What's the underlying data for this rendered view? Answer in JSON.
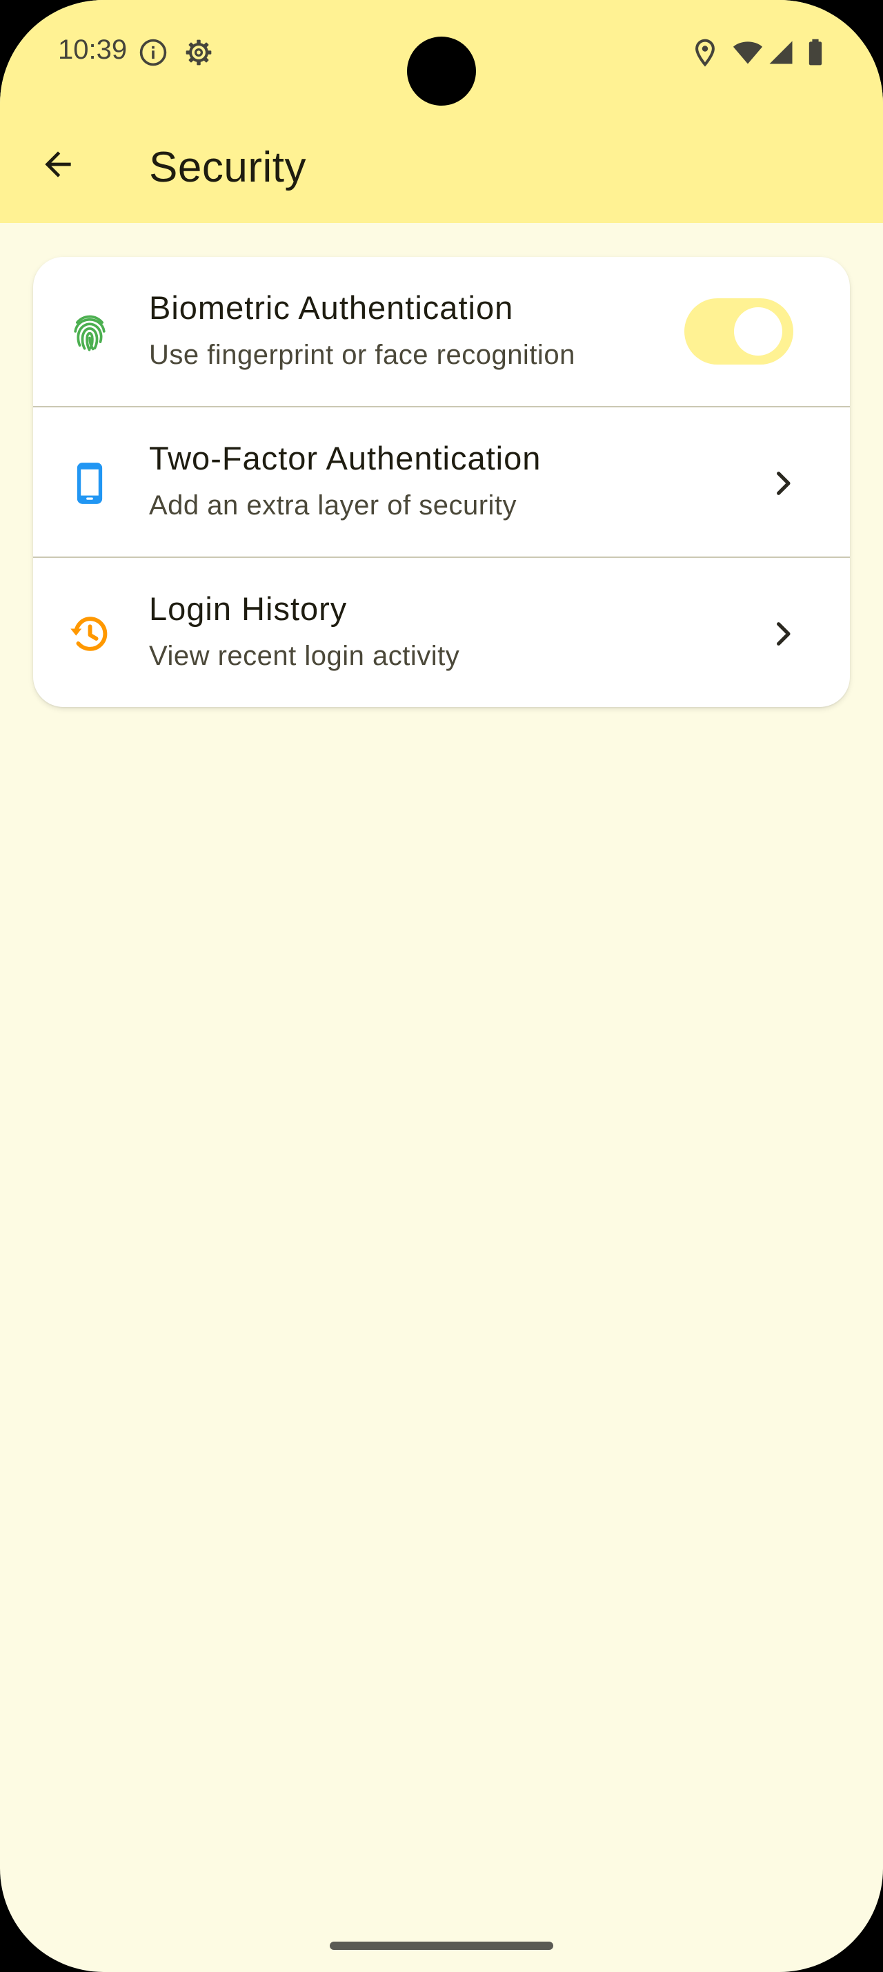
{
  "status_bar": {
    "time": "10:39",
    "left_icons": [
      "info-icon",
      "settings-gear-icon"
    ],
    "right_icons": [
      "location-icon",
      "wifi-icon",
      "cell-signal-icon",
      "battery-icon"
    ]
  },
  "app_bar": {
    "title": "Security",
    "back_icon": "arrow-back-icon"
  },
  "settings": [
    {
      "id": "biometric",
      "icon": "fingerprint-icon",
      "icon_color": "#4CAF50",
      "title": "Biometric Authentication",
      "subtitle": "Use fingerprint or face recognition",
      "control": "toggle",
      "toggle_on": true
    },
    {
      "id": "two-factor",
      "icon": "phone-icon",
      "icon_color": "#2196F3",
      "title": "Two-Factor Authentication",
      "subtitle": "Add an extra layer of security",
      "control": "chevron"
    },
    {
      "id": "login-history",
      "icon": "history-icon",
      "icon_color": "#FF9800",
      "title": "Login History",
      "subtitle": "View recent login activity",
      "control": "chevron"
    }
  ],
  "colors": {
    "header_background": "#FFF293",
    "page_background": "#FDFBE3",
    "toggle_track": "#FFF293",
    "card_background": "#FFFFFF"
  }
}
